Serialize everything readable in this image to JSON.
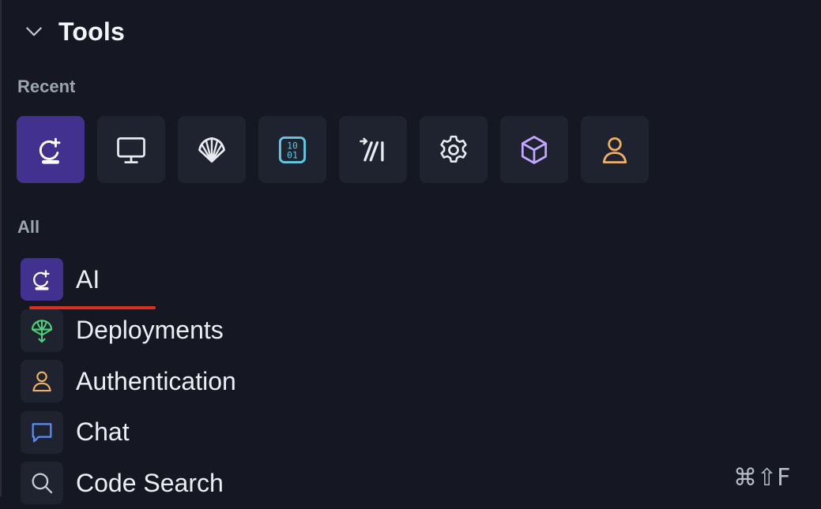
{
  "panel": {
    "title": "Tools",
    "chevron_icon": "chevron-down-icon",
    "recent_label": "Recent",
    "all_label": "All"
  },
  "recent": [
    {
      "name": "ai",
      "icon": "ai-sparkle-icon",
      "active": true,
      "color": "#ffffff"
    },
    {
      "name": "monitor",
      "icon": "monitor-icon",
      "active": false,
      "color": "#e8eaf0"
    },
    {
      "name": "shell",
      "icon": "shell-icon",
      "active": false,
      "color": "#e8eaf0"
    },
    {
      "name": "binary",
      "icon": "binary-icon",
      "active": false,
      "color": "#5ec8e5"
    },
    {
      "name": "linear",
      "icon": "linear-icon",
      "active": false,
      "color": "#e8eaf0"
    },
    {
      "name": "settings",
      "icon": "gear-icon",
      "active": false,
      "color": "#e8eaf0"
    },
    {
      "name": "package",
      "icon": "cube-icon",
      "active": false,
      "color": "#c3a6ff"
    },
    {
      "name": "user",
      "icon": "user-icon",
      "active": false,
      "color": "#f0b063"
    }
  ],
  "tools": [
    {
      "label": "AI",
      "icon": "ai-sparkle-icon",
      "active": true
    },
    {
      "label": "Deployments",
      "icon": "deployments-icon",
      "color": "#4fd17a"
    },
    {
      "label": "Authentication",
      "icon": "user-icon",
      "color": "#f0b063"
    },
    {
      "label": "Chat",
      "icon": "chat-icon",
      "color": "#5b8ef0"
    },
    {
      "label": "Code Search",
      "icon": "search-icon",
      "color": "#c9ccd6"
    }
  ],
  "shortcut": {
    "code_search": "⌘⇧F"
  }
}
